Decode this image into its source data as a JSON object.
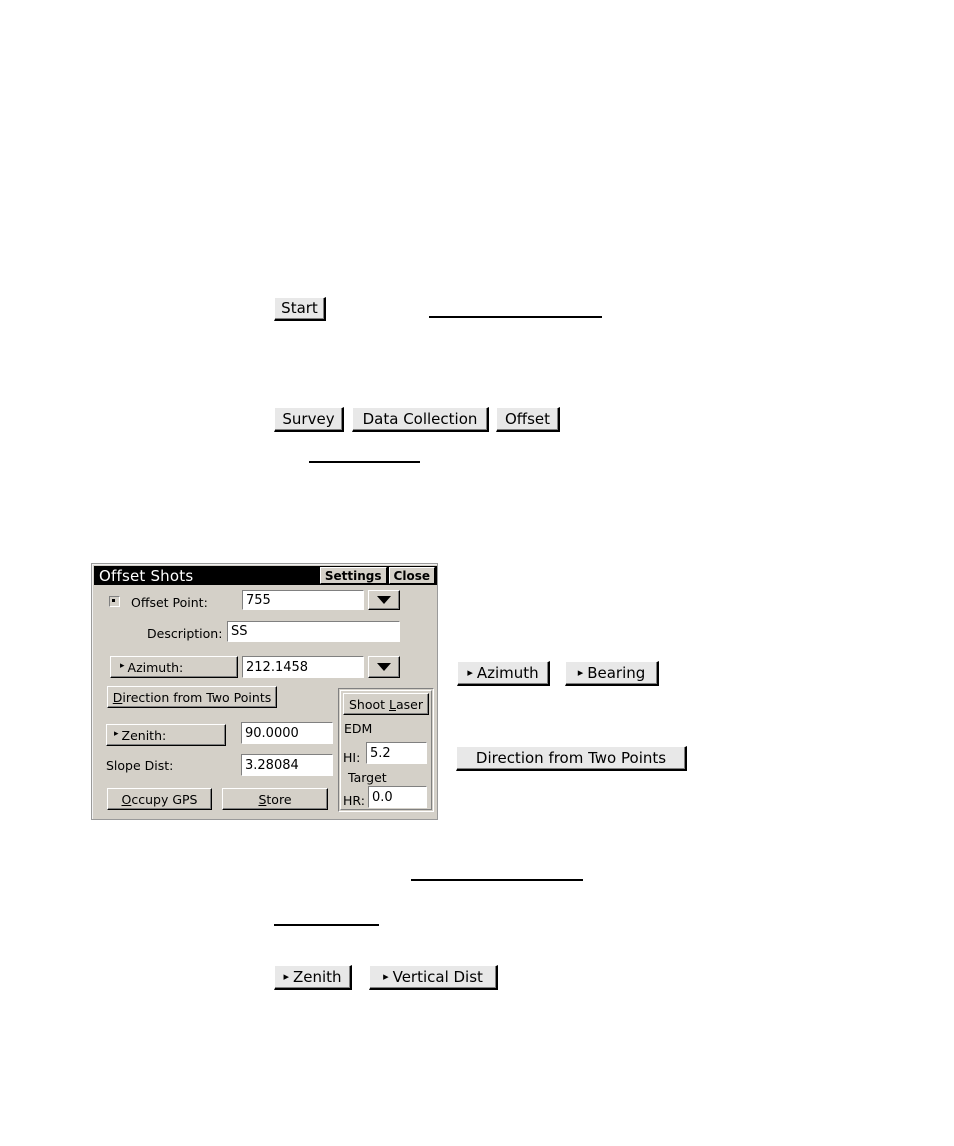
{
  "steps": {
    "start_button": "Start",
    "menu_buttons": [
      "Survey",
      "Data Collection",
      "Offset"
    ]
  },
  "side_buttons": {
    "azimuth": "Azimuth",
    "bearing": "Bearing",
    "direction_from_two_points": "Direction from Two Points",
    "zenith": "Zenith",
    "vertical_dist": "Vertical Dist",
    "triangle_glyph": "▸"
  },
  "dialog": {
    "title": "Offset Shots",
    "titlebar_buttons": {
      "settings": "Settings",
      "close": "Close"
    },
    "fields": {
      "offset_point_label": "Offset Point:",
      "offset_point_value": "755",
      "description_label": "Description:",
      "description_value": "SS",
      "azimuth_label": "Azimuth:",
      "azimuth_value": "212.1458",
      "direction_two_points_button": "Direction from Two Points",
      "direction_two_points_accel": "D",
      "zenith_label": "Zenith:",
      "zenith_value": "90.0000",
      "slope_dist_label": "Slope Dist:",
      "slope_dist_value": "3.28084"
    },
    "laser_panel": {
      "shoot_laser_pre": "Shoot ",
      "shoot_laser_accel": "L",
      "shoot_laser_post": "aser",
      "edm_label": "EDM",
      "hi_label": "HI:",
      "hi_value": "5.2",
      "target_label": "Target",
      "hr_label": "HR:",
      "hr_value": "0.0"
    },
    "footer": {
      "occupy_gps_accel": "O",
      "occupy_gps_rest": "ccupy GPS",
      "store_accel": "S",
      "store_rest": "tore"
    },
    "colors": {
      "face": "#d4d0c8",
      "titlebar": "#000000",
      "titlebar_text": "#ffffff",
      "field_bg": "#ffffff"
    }
  }
}
